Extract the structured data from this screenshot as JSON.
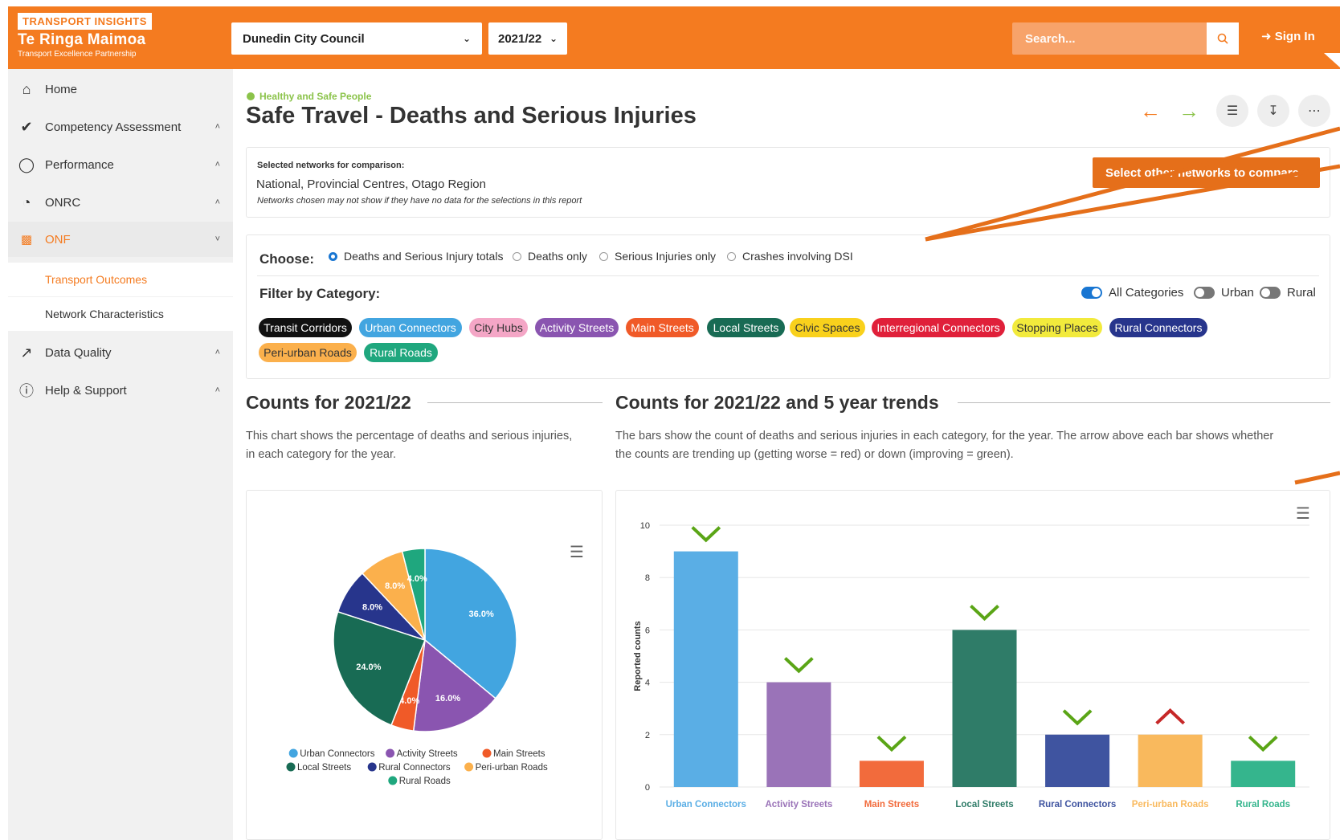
{
  "header": {
    "brand_badge": "TRANSPORT INSIGHTS",
    "brand_title": "Te Ringa Maimoa",
    "brand_sub": "Transport Excellence Partnership",
    "council_select": "Dunedin City Council",
    "year_select": "2021/22",
    "search_placeholder": "Search...",
    "signin_label": "Sign In",
    "accent": "#f47b20"
  },
  "sidebar": {
    "items": [
      {
        "label": "Home",
        "icon": "home-icon"
      },
      {
        "label": "Competency Assessment",
        "icon": "check-circle-icon"
      },
      {
        "label": "Performance",
        "icon": "award-icon"
      },
      {
        "label": "ONRC",
        "icon": "pie-icon"
      },
      {
        "label": "ONF",
        "icon": "grid-icon"
      },
      {
        "label": "Data Quality",
        "icon": "trend-icon"
      },
      {
        "label": "Help & Support",
        "icon": "help-icon"
      }
    ],
    "sub_items": [
      {
        "label": "Transport Outcomes"
      },
      {
        "label": "Network Characteristics"
      }
    ]
  },
  "page": {
    "breadcrumb": "Healthy and Safe People",
    "title": "Safe Travel - Deaths and Serious Injuries"
  },
  "comparison": {
    "label": "Selected networks for comparison:",
    "value": "National, Provincial Centres, Otago Region",
    "note": "Networks chosen may not show if they have no data for the selections in this report",
    "button_label": "Select other networks to compare"
  },
  "choose": {
    "label": "Choose:",
    "options": [
      "Deaths and Serious Injury totals",
      "Deaths only",
      "Serious Injuries only",
      "Crashes involving DSI"
    ],
    "selected": "Deaths and Serious Injury totals"
  },
  "filter": {
    "label": "Filter by Category:",
    "toggles": [
      {
        "label": "All Categories",
        "on": true
      },
      {
        "label": "Urban",
        "on": false
      },
      {
        "label": "Rural",
        "on": false
      }
    ],
    "chips": [
      {
        "label": "Transit Corridors",
        "bg": "#111111",
        "fg": "#ffffff"
      },
      {
        "label": "Urban Connectors",
        "bg": "#42a5e0",
        "fg": "#ffffff"
      },
      {
        "label": "City Hubs",
        "bg": "#f4a6c6",
        "fg": "#333333"
      },
      {
        "label": "Activity Streets",
        "bg": "#8a55b0",
        "fg": "#ffffff"
      },
      {
        "label": "Main Streets",
        "bg": "#f05a28",
        "fg": "#ffffff"
      },
      {
        "label": "Local Streets",
        "bg": "#186b54",
        "fg": "#ffffff"
      },
      {
        "label": "Civic Spaces",
        "bg": "#f9d11c",
        "fg": "#333333"
      },
      {
        "label": "Interregional Connectors",
        "bg": "#e0203a",
        "fg": "#ffffff"
      },
      {
        "label": "Stopping Places",
        "bg": "#f2ea3c",
        "fg": "#333333"
      },
      {
        "label": "Rural Connectors",
        "bg": "#27358c",
        "fg": "#ffffff"
      },
      {
        "label": "Peri-urban Roads",
        "bg": "#fbb04c",
        "fg": "#333333"
      },
      {
        "label": "Rural Roads",
        "bg": "#1fa77e",
        "fg": "#ffffff"
      }
    ]
  },
  "left_section": {
    "title": "Counts for 2021/22",
    "desc_line1": "This chart shows the percentage of deaths and serious injuries,",
    "desc_line2": "in each category for the year."
  },
  "right_section": {
    "title": "Counts for 2021/22 and 5 year trends",
    "desc_line1": "The bars show the count of deaths and serious injuries in each category, for the year. The arrow above each bar shows whether",
    "desc_line2": "the counts are trending up (getting worse = red) or down (improving = green)."
  },
  "chart_data": [
    {
      "type": "pie",
      "categories": [
        "Urban Connectors",
        "Activity Streets",
        "Main Streets",
        "Local Streets",
        "Rural Connectors",
        "Peri-urban Roads",
        "Rural Roads"
      ],
      "values": [
        36.0,
        16.0,
        4.0,
        24.0,
        8.0,
        8.0,
        4.0
      ],
      "labels": [
        "36.0%",
        "16.0%",
        "4.0%",
        "24.0%",
        "8.0%",
        "8.0%",
        "4.0%"
      ],
      "colors": [
        "#42a5e0",
        "#8a55b0",
        "#f05a28",
        "#186b54",
        "#27358c",
        "#fbb04c",
        "#1fa77e"
      ],
      "legend": "bottom"
    },
    {
      "type": "bar",
      "categories": [
        "Urban Connectors",
        "Activity Streets",
        "Main Streets",
        "Local Streets",
        "Rural Connectors",
        "Peri-urban Roads",
        "Rural Roads"
      ],
      "values": [
        9,
        4,
        1,
        6,
        2,
        2,
        1
      ],
      "trends": [
        "down",
        "down",
        "down",
        "down",
        "down",
        "up",
        "down"
      ],
      "colors": [
        "#5aaee5",
        "#9a73b8",
        "#f26b3c",
        "#2f7c68",
        "#3f54a0",
        "#f9b95d",
        "#35b58d"
      ],
      "ylabel": "Reported counts",
      "ylim": [
        0,
        10
      ],
      "yticks": [
        0,
        2,
        4,
        6,
        8,
        10
      ],
      "trend_colors": {
        "down": "#5aa516",
        "up": "#c62828"
      }
    }
  ]
}
